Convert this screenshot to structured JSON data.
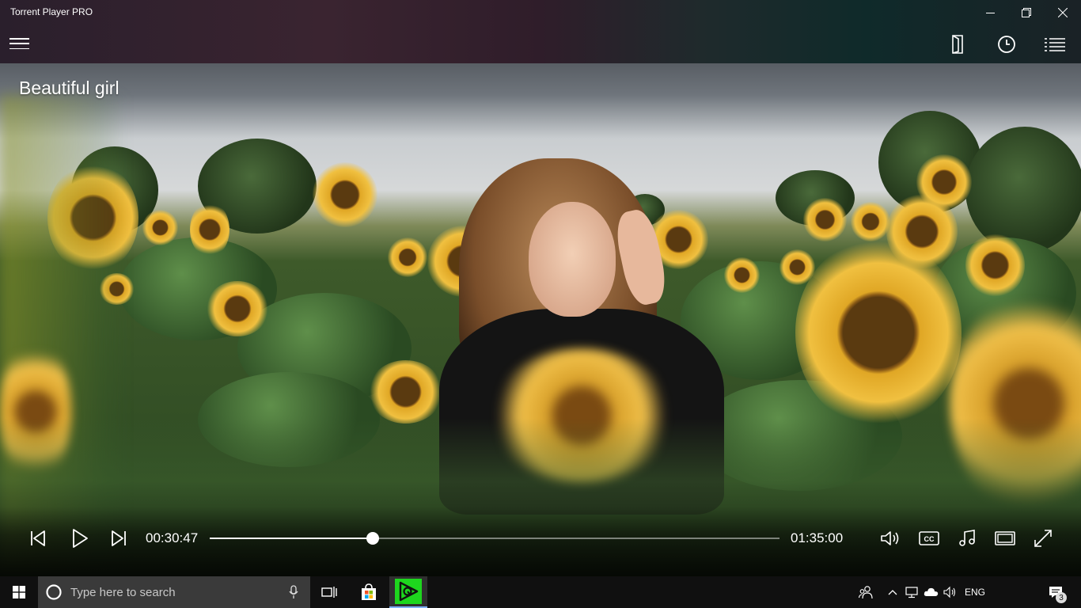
{
  "window": {
    "title": "Torrent Player PRO",
    "minimize_icon": "minimize-icon",
    "restore_icon": "restore-icon",
    "close_icon": "close-icon"
  },
  "toolbar": {
    "menu_icon": "hamburger-menu-icon",
    "right_icons": [
      "open-file-icon",
      "history-clock-icon",
      "playlist-icon"
    ]
  },
  "video": {
    "title": "Beautiful girl"
  },
  "player": {
    "current_time": "00:30:47",
    "total_time": "01:35:00",
    "progress": 0.286,
    "buttons": [
      "previous-icon",
      "play-icon",
      "next-icon",
      "volume-icon",
      "closed-captions-icon",
      "audio-track-icon",
      "aspect-ratio-icon",
      "fullscreen-icon"
    ],
    "cc_label": "CC"
  },
  "taskbar": {
    "search_placeholder": "Type here to search",
    "language": "ENG",
    "notification_count": "3",
    "pinned_apps": [
      "task-view-icon",
      "store-icon",
      "torrent-player-icon"
    ]
  },
  "colors": {
    "accent": "#ffffff",
    "taskbar_bg": "#101010",
    "search_bg": "#3a3a3a",
    "app_icon_green": "#1ed61e"
  }
}
